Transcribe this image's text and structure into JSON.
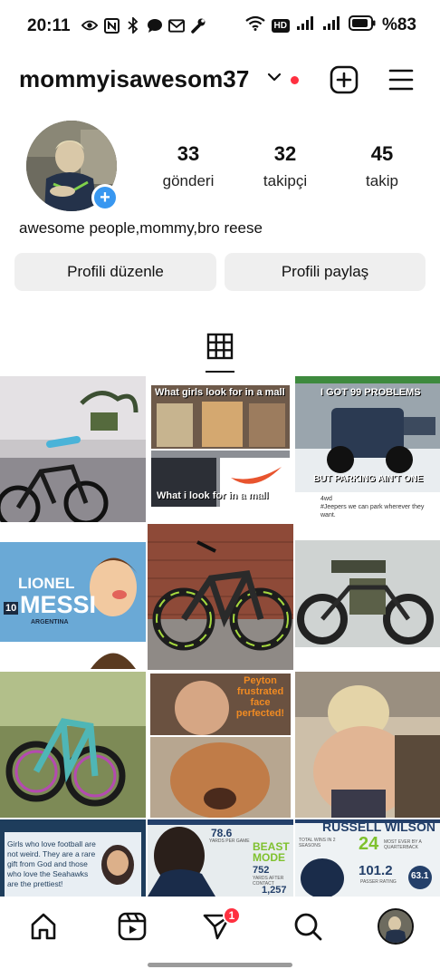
{
  "status_bar": {
    "time": "20:11",
    "battery_percent": "%83",
    "hd_label": "HD"
  },
  "header": {
    "username": "mommyisawesom37",
    "accent_dot_color": "#ff3040"
  },
  "profile": {
    "stats": [
      {
        "number": "33",
        "label": "gönderi"
      },
      {
        "number": "32",
        "label": "takipçi"
      },
      {
        "number": "45",
        "label": "takip"
      }
    ],
    "bio": "awesome people,mommy,bro reese",
    "edit_button": "Profili düzenle",
    "share_button": "Profili paylaş",
    "add_story_color": "#3897f0"
  },
  "grid_posts": {
    "p2_top": "What girls look for in a mall",
    "p2_bottom": "What i look for in a mall",
    "p3_top": "I GOT 99 PROBLEMS",
    "p3_bottom": "BUT PARKING AIN'T ONE",
    "p3_account": "4wd",
    "p3_caption": "#Jeepers we can park wherever they want.",
    "p4_number": "10",
    "p4_first": "LIONEL",
    "p4_last": "MESSI",
    "p4_country": "ARGENTINA",
    "p8_text": "Peyton frustrated face perfected!",
    "p10_text": "Girls who love football are not weird. They are a rare gift from God and those who love the Seahawks are the prettiest!",
    "p11_stat1": "78.6",
    "p11_stat1_label": "YARDS PER GAME",
    "p11_title": "BEAST MODE",
    "p11_stat2": "752",
    "p11_stat2_label": "YARDS AFTER CONTACT",
    "p11_stat3": "1,257",
    "p12_title": "RUSSELL WILSON",
    "p12_number": "24",
    "p12_label1": "TOTAL WINS IN 2 SEASONS",
    "p12_label2": "MOST EVER BY A QUARTERBACK",
    "p12_stat1": "101.2",
    "p12_stat1_label": "PASSER RATING",
    "p12_stat2": "63.1"
  },
  "bottom_nav": {
    "notification_count": "1"
  },
  "icons": [
    "eye-icon",
    "nfc-icon",
    "bluetooth-icon",
    "chat-icon",
    "gmail-icon",
    "wrench-icon",
    "wifi-icon",
    "signal-icon",
    "battery-icon",
    "chevron-down-icon",
    "add-post-icon",
    "menu-icon",
    "grid-icon",
    "home-icon",
    "reels-icon",
    "messages-icon",
    "search-icon"
  ]
}
